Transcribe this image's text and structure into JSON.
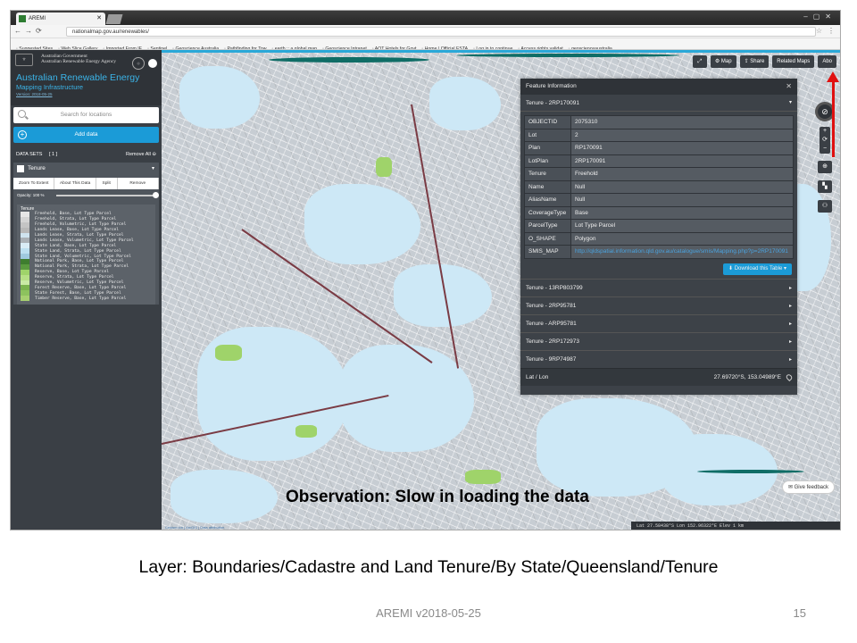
{
  "browser": {
    "tab_title": "AREMI",
    "url": "nationalmap.gov.au/renewables/",
    "bookmarks": [
      "Suggested Sites",
      "Web Slice Gallery",
      "Imported From IE",
      "Sentinel",
      "Geoscience Australia",
      "Pathfinding for Tow",
      "earth :: a global map",
      "Geoscience Intranet",
      "AOT Hotels for Govt",
      "Home | Official ESTA",
      "Log in to continue",
      "Access rights validat",
      "geoscienceaustralia"
    ]
  },
  "sidebar": {
    "gov_line1": "Australian Government",
    "gov_line2": "Australian Renewable Energy Agency",
    "title_line1": "Australian Renewable Energy",
    "title_line2": "Mapping Infrastructure",
    "version_link": "Version: 2018-05-25",
    "search_placeholder": "Search for locations",
    "add_data": "Add data",
    "datasets_label": "DATA SETS",
    "datasets_count": "[ 1 ]",
    "remove_all": "Remove All",
    "layer_name": "Tenure",
    "actions": [
      "Zoom To Extent",
      "About This Data",
      "Split",
      "Remove"
    ],
    "opacity": "Opacity: 100 %",
    "legend_title": "Tenure",
    "legend": [
      {
        "label": "Freehold, Base, Lot Type Parcel",
        "color": "#e6e6e6"
      },
      {
        "label": "Freehold, Strata, Lot Type Parcel",
        "color": "#d4d4d4"
      },
      {
        "label": "Freehold, Volumetric, Lot Type Parcel",
        "color": "#c4c4c4"
      },
      {
        "label": "Lands Lease, Base, Lot Type Parcel",
        "color": "#b8b8b8"
      },
      {
        "label": "Lands Lease, Strata, Lot Type Parcel",
        "color": "#cfe3ef"
      },
      {
        "label": "Lands Lease, Volumetric, Lot Type Parcel",
        "color": "#aab0b6"
      },
      {
        "label": "State Land, Base, Lot Type Parcel",
        "color": "#d9ecf6"
      },
      {
        "label": "State Land, Strata, Lot Type Parcel",
        "color": "#bcdff0"
      },
      {
        "label": "State Land, Volumetric, Lot Type Parcel",
        "color": "#9fc9df"
      },
      {
        "label": "National Park, Base, Lot Type Parcel",
        "color": "#3e7d2f"
      },
      {
        "label": "National Park, Strata, Lot Type Parcel",
        "color": "#5a9a3f"
      },
      {
        "label": "Reserve, Base, Lot Type Parcel",
        "color": "#9fd36a"
      },
      {
        "label": "Reserve, Strata, Lot Type Parcel",
        "color": "#b6df86"
      },
      {
        "label": "Reserve, Volumetric, Lot Type Parcel",
        "color": "#c9e9a5"
      },
      {
        "label": "Forest Reserve, Base, Lot Type Parcel",
        "color": "#7bb34f"
      },
      {
        "label": "State Forest, Base, Lot Type Parcel",
        "color": "#8dc25e"
      },
      {
        "label": "Timber Reserve, Base, Lot Type Parcel",
        "color": "#a6cf70"
      }
    ]
  },
  "map": {
    "top_buttons": [
      "Map",
      "Share",
      "Related Maps",
      "Abo"
    ],
    "feedback": "Give feedback",
    "status": "Lat  27.58438°S    Lon  152.96322°E    Elev                           1 km",
    "attribution": "Cesium ion | ArcGIS | Data attribution"
  },
  "feature": {
    "header": "Feature Information",
    "selected": "Tenure - 2RP170091",
    "rows": [
      {
        "k": "OBJECTID",
        "v": "2075310"
      },
      {
        "k": "Lot",
        "v": "2"
      },
      {
        "k": "Plan",
        "v": "RP170091"
      },
      {
        "k": "LotPlan",
        "v": "2RP170091"
      },
      {
        "k": "Tenure",
        "v": "Freehold"
      },
      {
        "k": "Name",
        "v": "Null"
      },
      {
        "k": "AliasName",
        "v": "Null"
      },
      {
        "k": "CoverageType",
        "v": "Base"
      },
      {
        "k": "ParcelType",
        "v": "Lot Type Parcel"
      },
      {
        "k": "O_SHAPE",
        "v": "Polygon"
      },
      {
        "k": "SMIS_MAP",
        "v": "http://qldspatial.information.qld.gov.au/catalogue/smis/Mapping.php?p=2RP170091"
      }
    ],
    "download": "Download this Table ▾",
    "others": [
      "Tenure - 13RP803799",
      "Tenure - 2RP95781",
      "Tenure - ARP95781",
      "Tenure - 2RP172973",
      "Tenure - 9RP74987"
    ],
    "latlon_label": "Lat / Lon",
    "latlon_value": "27.69720°S, 153.04989°E"
  },
  "slide": {
    "observation": "Observation: Slow in loading the data",
    "layer_caption": "Layer: Boundaries/Cadastre and Land Tenure/By State/Queensland/Tenure",
    "footer": "AREMI v2018-05-25",
    "page_number": "15"
  }
}
